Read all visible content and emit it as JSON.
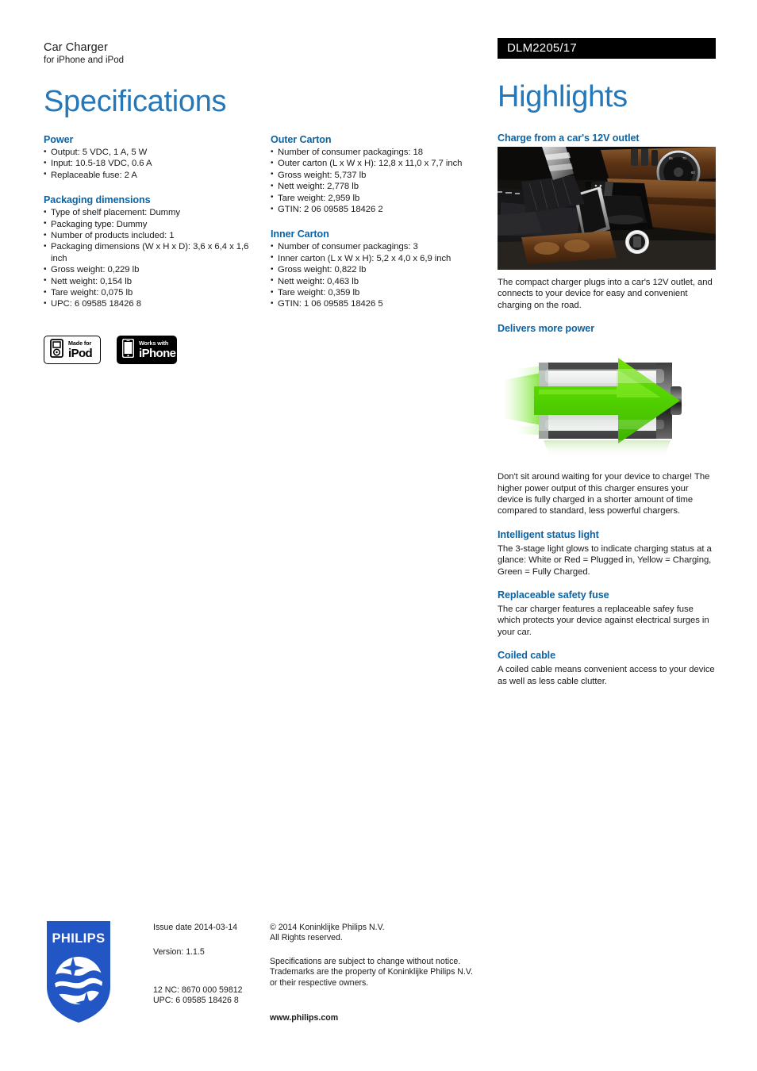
{
  "header": {
    "product_name": "Car Charger",
    "product_subtitle": "for iPhone and iPod",
    "specifications_title": "Specifications",
    "model_number": "DLM2205/17",
    "highlights_title": "Highlights"
  },
  "colors": {
    "heading_blue": "#0a64a5",
    "title_blue": "#2478b9",
    "model_bar_bg": "#000000",
    "philips_blue": "#2156c4",
    "battery_green": "#5bd400"
  },
  "specifications": {
    "column1": [
      {
        "heading": "Power",
        "items": [
          "Output: 5 VDC, 1 A, 5 W",
          "Input: 10.5-18 VDC, 0.6 A",
          "Replaceable fuse: 2 A"
        ]
      },
      {
        "heading": "Packaging dimensions",
        "items": [
          "Type of shelf placement: Dummy",
          "Packaging type: Dummy",
          "Number of products included: 1",
          "Packaging dimensions (W x H x D): 3,6 x 6,4 x 1,6 inch",
          "Gross weight: 0,229 lb",
          "Nett weight: 0,154 lb",
          "Tare weight: 0,075 lb",
          "UPC: 6 09585 18426 8"
        ]
      }
    ],
    "column2": [
      {
        "heading": "Outer Carton",
        "items": [
          "Number of consumer packagings: 18",
          "Outer carton (L x W x H): 12,8 x 11,0 x 7,7 inch",
          "Gross weight: 5,737 lb",
          "Nett weight: 2,778 lb",
          "Tare weight: 2,959 lb",
          "GTIN: 2 06 09585 18426 2"
        ]
      },
      {
        "heading": "Inner Carton",
        "items": [
          "Number of consumer packagings: 3",
          "Inner carton (L x W x H): 5,2 x 4,0 x 6,9 inch",
          "Gross weight: 0,822 lb",
          "Nett weight: 0,463 lb",
          "Tare weight: 0,359 lb",
          "GTIN: 1 06 09585 18426 5"
        ]
      }
    ]
  },
  "badges": [
    {
      "small": "Made for",
      "big": "iPod",
      "icon": "ipod-device-icon",
      "style": "light"
    },
    {
      "small": "Works with",
      "big": "iPhone",
      "icon": "iphone-device-icon",
      "style": "dark"
    }
  ],
  "highlights": [
    {
      "heading": "Charge from a car's 12V outlet",
      "image": "car-center-console-12v-outlet-photo",
      "body": "The compact charger plugs into a car's 12V outlet, and connects to your device for easy and convenient charging on the road."
    },
    {
      "heading": "Delivers more power",
      "image": "battery-with-green-arrow-illustration",
      "body": "Don't sit around waiting for your device to charge! The higher power output of this charger ensures your device is fully charged in a shorter amount of time compared to standard, less powerful chargers."
    },
    {
      "heading": "Intelligent status light",
      "image": null,
      "body": "The 3-stage light glows to indicate charging status at a glance: White or Red = Plugged in, Yellow = Charging, Green = Fully Charged."
    },
    {
      "heading": "Replaceable safety fuse",
      "image": null,
      "body": "The car charger features a replaceable safey fuse which protects your device against electrical surges in your car."
    },
    {
      "heading": "Coiled cable",
      "image": null,
      "body": "A coiled cable means convenient access to your device as well as less cable clutter."
    }
  ],
  "footer": {
    "logo": "philips-shield-logo",
    "logo_wordmark": "PHILIPS",
    "issue_date": "Issue date 2014-03-14",
    "version": "Version: 1.1.5",
    "nc_code": "12 NC: 8670 000 59812",
    "upc": "UPC: 6 09585 18426 8",
    "copyright_line1": "© 2014 Koninklijke Philips N.V.",
    "copyright_line2": "All Rights reserved.",
    "disclaimer_line1": "Specifications are subject to change without notice.",
    "disclaimer_line2": "Trademarks are the property of Koninklijke Philips N.V.",
    "disclaimer_line3": "or their respective owners.",
    "website": "www.philips.com"
  }
}
